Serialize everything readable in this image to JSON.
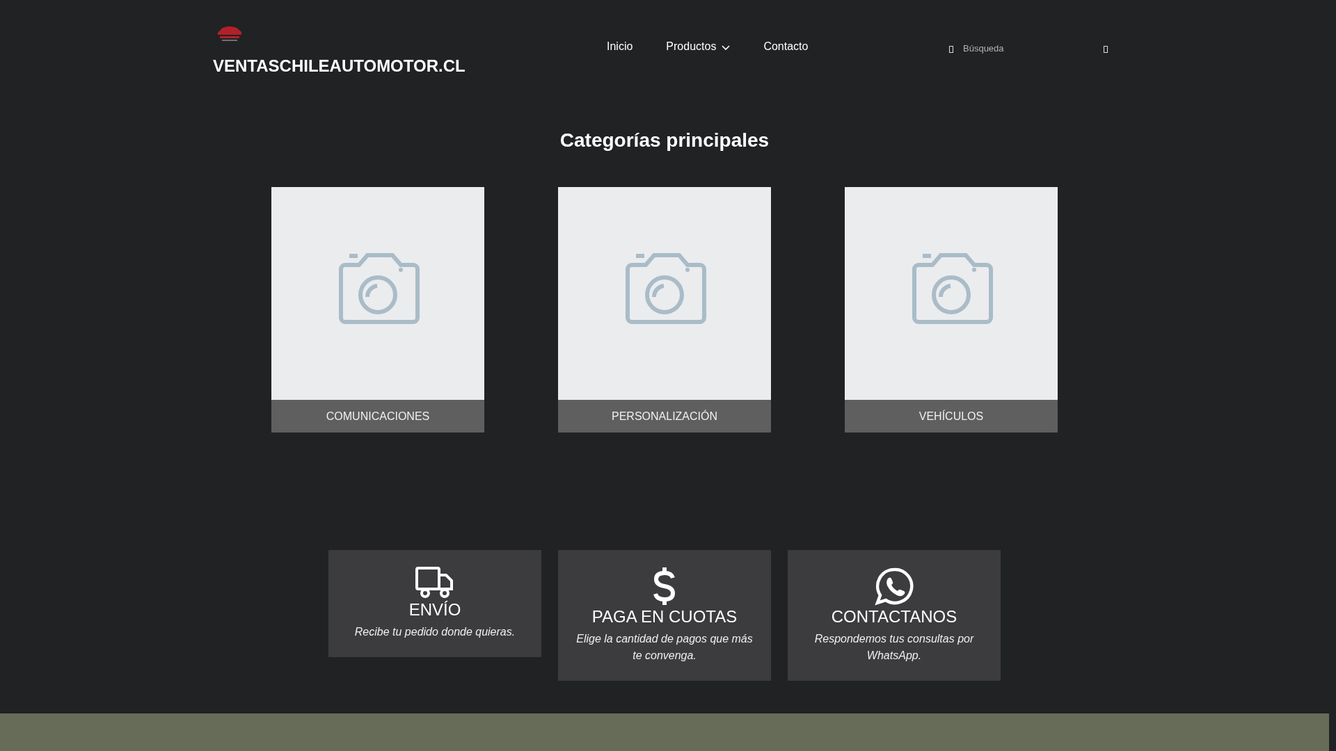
{
  "header": {
    "site_title": "VENTASCHILEAUTOMOTOR.CL",
    "nav": [
      {
        "label": "Inicio",
        "dropdown": false
      },
      {
        "label": "Productos",
        "dropdown": true
      },
      {
        "label": "Contacto",
        "dropdown": false
      }
    ],
    "search": {
      "placeholder": "Búsqueda"
    }
  },
  "categories": {
    "title": "Categorías principales",
    "items": [
      {
        "label": "COMUNICACIONES",
        "kind": "picture"
      },
      {
        "label": "PERSONALIZACIÓN",
        "kind": "picture"
      },
      {
        "label": "VEHÍCULOS",
        "kind": "picture"
      }
    ]
  },
  "features": [
    {
      "kind": "truck",
      "title": "ENVÍO",
      "text": "Recibe tu pedido donde quieras."
    },
    {
      "kind": "dollar",
      "title": "PAGA EN CUOTAS",
      "text": "Elige la cantidad de pagos que más te convenga."
    },
    {
      "kind": "whatsapp",
      "title": "CONTACTANOS",
      "text": "Respondemos tus consultas por WhatsApp."
    }
  ]
}
